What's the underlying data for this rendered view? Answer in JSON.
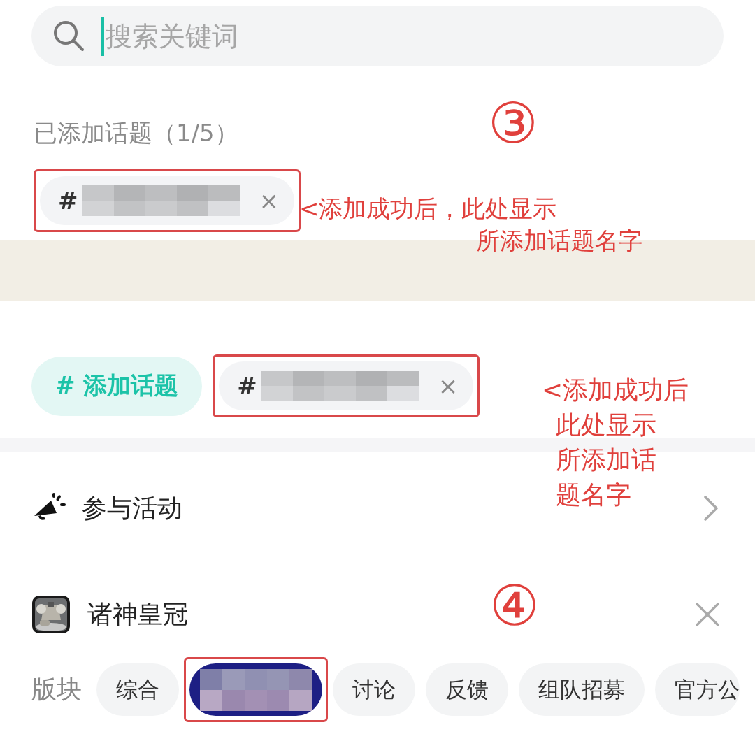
{
  "search": {
    "placeholder": "搜索关键词",
    "focused": true
  },
  "added_topics": {
    "heading": "已添加话题（1/5）",
    "step_mark": "③",
    "note": [
      "<添加成功后，此处显示",
      "所添加话题名字"
    ],
    "chips": [
      {
        "hash": "#",
        "redacted": true,
        "close": "×",
        "highlighted": true
      }
    ]
  },
  "topic_bar": {
    "add_button": "# 添加话题",
    "note": [
      "<添加成功后",
      "此处显示",
      "所添加话",
      "题名字"
    ],
    "chips": [
      {
        "hash": "#",
        "redacted": true,
        "close": "×",
        "highlighted": true
      }
    ]
  },
  "activity": {
    "label": "参与活动"
  },
  "game": {
    "name": "诸神皇冠",
    "step_mark": "④",
    "boards_label": "版块",
    "boards": [
      {
        "label": "综合",
        "selected": false,
        "highlighted": false
      },
      {
        "redacted": true,
        "selected": true,
        "highlighted": true
      },
      {
        "label": "讨论",
        "selected": false,
        "highlighted": false
      },
      {
        "label": "反馈",
        "selected": false,
        "highlighted": false
      },
      {
        "label": "组队招募",
        "selected": false,
        "highlighted": false
      },
      {
        "label": "官方公",
        "selected": false,
        "highlighted": false
      }
    ]
  }
}
